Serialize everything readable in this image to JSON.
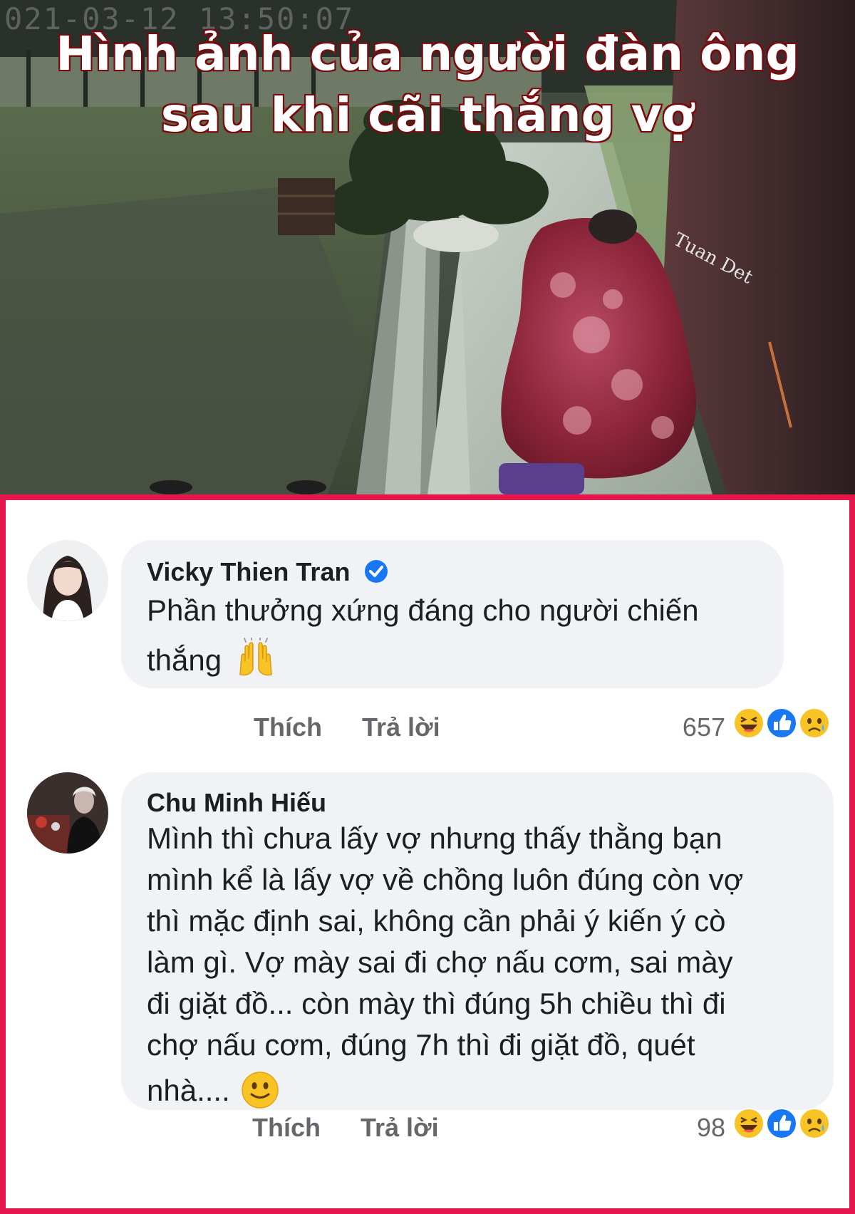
{
  "photo": {
    "headline_line1": "Hình ảnh của người đàn ông",
    "headline_line2": "sau khi cãi thắng vợ",
    "camera_timestamp": "021-03-12 13:50:07",
    "watermark": "Tuan Det"
  },
  "comments": [
    {
      "author": "Vicky Thien Tran",
      "verified": true,
      "text": "Phần thưởng xứng đáng cho người chiến thắng",
      "emoji": "raising-hands",
      "like_label": "Thích",
      "reply_label": "Trả lời",
      "reaction_count": "657",
      "reactions": [
        "haha",
        "like",
        "sad"
      ]
    },
    {
      "author": "Chu Minh Hiếu",
      "verified": false,
      "text": "Mình thì chưa lấy vợ nhưng thấy thằng bạn mình kể là lấy vợ về chồng luôn đúng còn vợ thì mặc định sai, không cần phải ý kiến ý cò làm gì. Vợ mày sai đi chợ nấu cơm, sai mày đi giặt đồ... còn mày thì đúng 5h chiều thì đi chợ nấu cơm, đúng 7h thì đi giặt đồ, quét nhà....",
      "text_lines": [
        "Mình thì chưa lấy vợ nhưng thấy thằng bạn",
        "mình kể là lấy vợ về chồng luôn đúng còn vợ",
        "thì mặc định sai, không cần phải ý kiến ý cò",
        "làm gì. Vợ mày sai đi chợ nấu cơm, sai mày",
        "đi giặt đồ... còn mày thì đúng 5h chiều thì đi",
        "chợ nấu cơm, đúng 7h thì đi giặt đồ, quét",
        "nhà...."
      ],
      "emoji": "slightly-smiling-face",
      "like_label": "Thích",
      "reply_label": "Trả lời",
      "reaction_count": "98",
      "reactions": [
        "haha",
        "like",
        "sad"
      ]
    }
  ],
  "comment1_lines": [
    "Phần thưởng xứng đáng cho người chiến",
    "thắng"
  ],
  "colors": {
    "frame_border": "#e5164c",
    "bubble": "#f0f2f5",
    "text": "#1c1e21",
    "muted": "#65676b",
    "verified": "#1877f2",
    "headline_stroke": "#9e0f14"
  }
}
